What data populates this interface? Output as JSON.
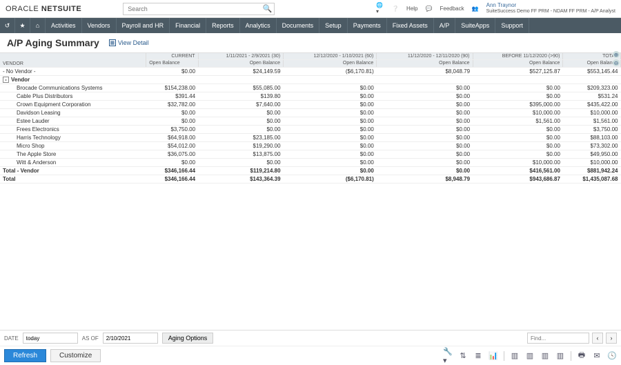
{
  "brand": {
    "part1": "ORACLE",
    "part2": "NETSUITE"
  },
  "search": {
    "placeholder": "Search"
  },
  "help_label": "Help",
  "feedback_label": "Feedback",
  "user": {
    "name": "Ann Traynor",
    "role": "SuiteSuccess Demo FF PRM - NDAM FF PRM - A/P Analyst"
  },
  "nav": [
    "Activities",
    "Vendors",
    "Payroll and HR",
    "Financial",
    "Reports",
    "Analytics",
    "Documents",
    "Setup",
    "Payments",
    "Fixed Assets",
    "A/P",
    "SuiteApps",
    "Support"
  ],
  "page_title": "A/P Aging Summary",
  "view_detail": "View Detail",
  "columns": {
    "col0": "VENDOR",
    "periods": [
      "CURRENT",
      "1/11/2021 - 2/9/2021 (30)",
      "12/12/2020 - 1/10/2021 (60)",
      "11/12/2020 - 12/11/2020 (90)",
      "BEFORE 11/12/2020 (>90)",
      "TOTAL"
    ],
    "sub": "Open Balance"
  },
  "rows": [
    {
      "type": "plain",
      "name": "- No Vendor -",
      "v": [
        "$0.00",
        "$24,149.59",
        "($6,170.81)",
        "$8,048.79",
        "$527,125.87",
        "$553,145.44"
      ]
    },
    {
      "type": "group",
      "name": "Vendor",
      "exp": "-",
      "v": [
        "",
        "",
        "",
        "",
        "",
        ""
      ]
    },
    {
      "type": "sub",
      "name": "Brocade Communications Systems",
      "v": [
        "$154,238.00",
        "$55,085.00",
        "$0.00",
        "$0.00",
        "$0.00",
        "$209,323.00"
      ]
    },
    {
      "type": "sub",
      "name": "Cable Plus Distributors",
      "v": [
        "$391.44",
        "$139.80",
        "$0.00",
        "$0.00",
        "$0.00",
        "$531.24"
      ]
    },
    {
      "type": "sub",
      "name": "Crown Equipment Corporation",
      "v": [
        "$32,782.00",
        "$7,640.00",
        "$0.00",
        "$0.00",
        "$395,000.00",
        "$435,422.00"
      ]
    },
    {
      "type": "sub",
      "name": "Davidson Leasing",
      "v": [
        "$0.00",
        "$0.00",
        "$0.00",
        "$0.00",
        "$10,000.00",
        "$10,000.00"
      ]
    },
    {
      "type": "sub",
      "name": "Estee Lauder",
      "v": [
        "$0.00",
        "$0.00",
        "$0.00",
        "$0.00",
        "$1,561.00",
        "$1,561.00"
      ]
    },
    {
      "type": "sub",
      "name": "Frees Electronics",
      "v": [
        "$3,750.00",
        "$0.00",
        "$0.00",
        "$0.00",
        "$0.00",
        "$3,750.00"
      ]
    },
    {
      "type": "sub",
      "name": "Harris Technology",
      "v": [
        "$64,918.00",
        "$23,185.00",
        "$0.00",
        "$0.00",
        "$0.00",
        "$88,103.00"
      ]
    },
    {
      "type": "sub",
      "name": "Micro Shop",
      "v": [
        "$54,012.00",
        "$19,290.00",
        "$0.00",
        "$0.00",
        "$0.00",
        "$73,302.00"
      ]
    },
    {
      "type": "sub",
      "name": "The Apple Store",
      "v": [
        "$36,075.00",
        "$13,875.00",
        "$0.00",
        "$0.00",
        "$0.00",
        "$49,950.00"
      ]
    },
    {
      "type": "sub",
      "name": "Witt & Anderson",
      "v": [
        "$0.00",
        "$0.00",
        "$0.00",
        "$0.00",
        "$10,000.00",
        "$10,000.00"
      ]
    },
    {
      "type": "total",
      "name": "Total - Vendor",
      "v": [
        "$346,166.44",
        "$119,214.80",
        "$0.00",
        "$0.00",
        "$416,561.00",
        "$881,942.24"
      ]
    },
    {
      "type": "total",
      "name": "Total",
      "v": [
        "$346,166.44",
        "$143,364.39",
        "($6,170.81)",
        "$8,948.79",
        "$943,686.87",
        "$1,435,087.68"
      ]
    }
  ],
  "footer": {
    "date_label": "DATE",
    "date_value": "today",
    "asof_label": "AS OF",
    "asof_value": "2/10/2021",
    "aging_btn": "Aging Options",
    "find_label": "Find...",
    "refresh": "Refresh",
    "customize": "Customize"
  }
}
